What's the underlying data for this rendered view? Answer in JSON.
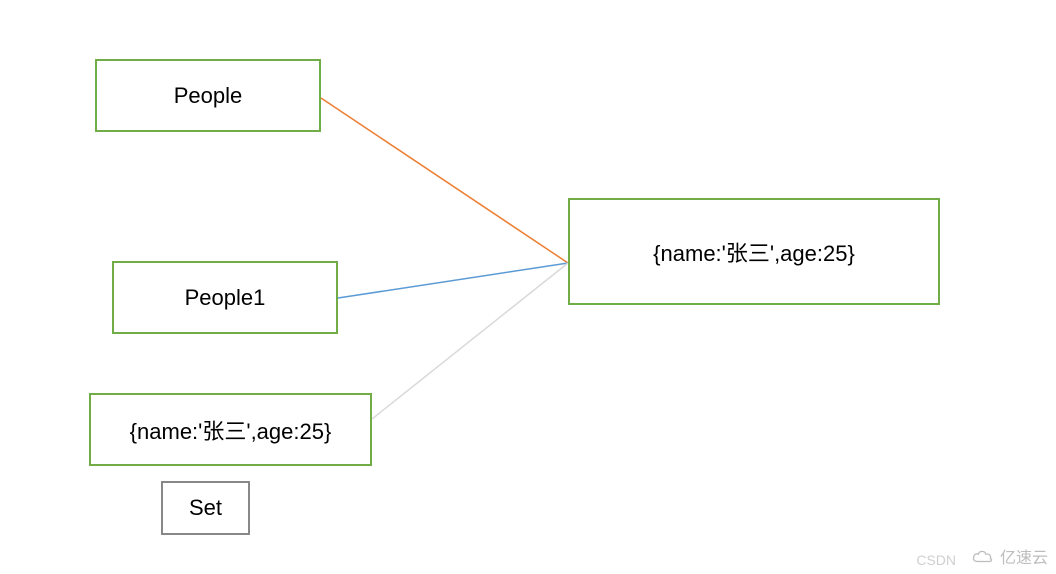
{
  "boxes": {
    "people": {
      "label": "People"
    },
    "people1": {
      "label": "People1"
    },
    "object_left": {
      "label": "{name:'张三',age:25}"
    },
    "object_right": {
      "label": "{name:'张三',age:25}"
    },
    "set": {
      "label": "Set"
    }
  },
  "connectors": {
    "line1": {
      "color": "#ed7d31"
    },
    "line2": {
      "color": "#5b9bd5"
    },
    "line3": {
      "color": "#d9d9d9"
    }
  },
  "watermark": {
    "csdn": "CSDN",
    "yisuyun": "亿速云"
  }
}
